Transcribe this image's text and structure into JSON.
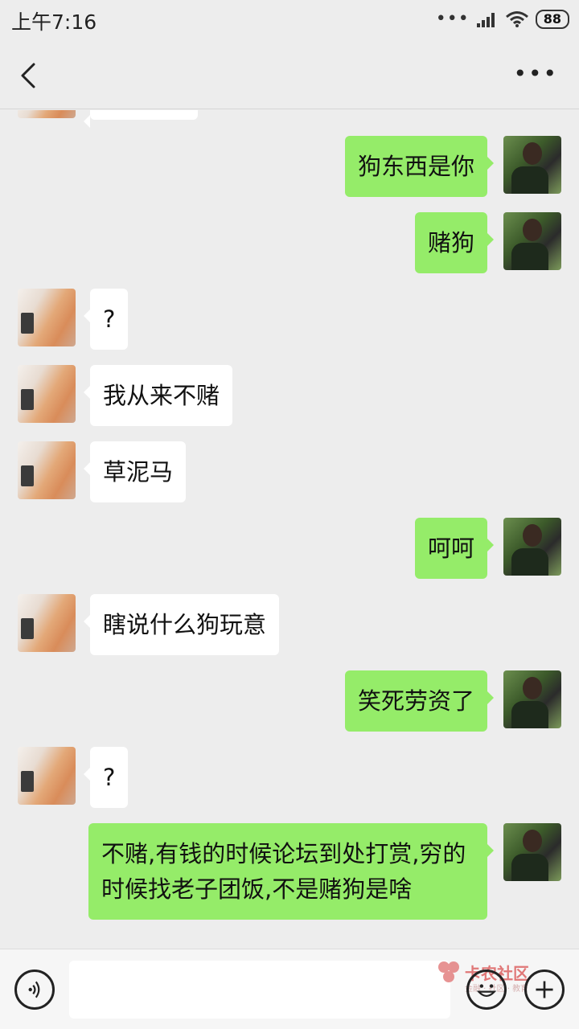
{
  "status_bar": {
    "time": "上午7:16",
    "battery": "88"
  },
  "messages": [
    {
      "side": "right",
      "avatar": "male",
      "text": "狗东西是你"
    },
    {
      "side": "right",
      "avatar": "male",
      "text": "赌狗"
    },
    {
      "side": "left",
      "avatar": "female",
      "text": "?"
    },
    {
      "side": "left",
      "avatar": "female",
      "text": "我从来不赌"
    },
    {
      "side": "left",
      "avatar": "female",
      "text": "草泥马"
    },
    {
      "side": "right",
      "avatar": "male",
      "text": "呵呵"
    },
    {
      "side": "left",
      "avatar": "female",
      "text": "瞎说什么狗玩意"
    },
    {
      "side": "right",
      "avatar": "male",
      "text": "笑死劳资了"
    },
    {
      "side": "left",
      "avatar": "female",
      "text": "?"
    },
    {
      "side": "right",
      "avatar": "male",
      "text": "不赌,有钱的时候论坛到处打赏,穷的时候找老子团饭,不是赌狗是啥"
    }
  ],
  "watermark": {
    "text": "卡农社区",
    "sub": "金融 · 社区 · 教育"
  },
  "colors": {
    "sent_bubble": "#95ec69",
    "received_bubble": "#ffffff",
    "background": "#ededed"
  },
  "icons": {
    "back": "chevron-left-icon",
    "more": "more-dots-icon",
    "voice": "voice-icon",
    "emoji": "emoji-icon",
    "plus": "plus-icon"
  }
}
